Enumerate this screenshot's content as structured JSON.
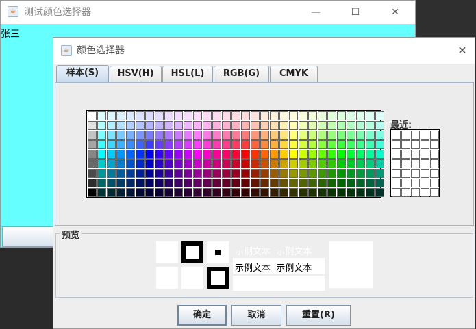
{
  "main_window": {
    "title": "测试颜色选择器",
    "content_text": "张三",
    "background_color": "#66ffff",
    "controls": {
      "minimize": "—",
      "maximize": "☐",
      "close": "✕"
    }
  },
  "dialog": {
    "title": "颜色选择器",
    "close_glyph": "✕",
    "tabs": [
      {
        "label": "样本(S)",
        "selected": true
      },
      {
        "label": "HSV(H)"
      },
      {
        "label": "HSL(L)"
      },
      {
        "label": "RGB(G)"
      },
      {
        "label": "CMYK"
      }
    ],
    "recent_label": "最近:",
    "preview_title": "预览",
    "sample_text": "示例文本",
    "buttons": {
      "ok": "确定",
      "cancel": "取消",
      "reset": "重置(R)"
    }
  },
  "icons": {
    "app_icon": "java-cup-icon"
  }
}
